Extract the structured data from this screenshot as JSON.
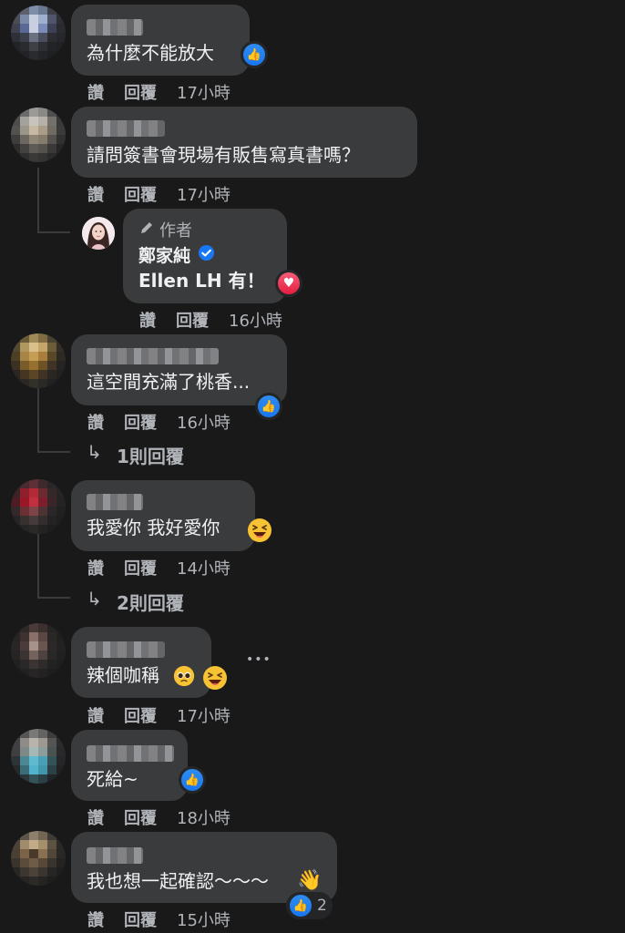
{
  "actions": {
    "like": "讚",
    "reply": "回覆"
  },
  "comments": [
    {
      "text": "為什麼不能放大",
      "time": "17小時"
    },
    {
      "text": "請問簽書會現場有販售寫真書嗎？",
      "time": "17小時"
    },
    {
      "author_badge": "作者",
      "author_name": "鄭家純",
      "text": "Ellen LH 有！",
      "time": "16小時"
    },
    {
      "text": "這空間充滿了桃香...",
      "time": "16小時",
      "replies": "1則回覆"
    },
    {
      "text": "我愛你 我好愛你",
      "time": "14小時",
      "replies": "2則回覆"
    },
    {
      "text": "辣個咖稱",
      "time": "17小時"
    },
    {
      "text": "死給~",
      "time": "18小時"
    },
    {
      "text": "我也想一起確認～～～",
      "time": "15小時",
      "reaction_count": "2"
    }
  ],
  "more_options": "•••",
  "colors": {
    "background": "#19191a",
    "bubble": "#3a3b3c",
    "like_blue": "#1877f2",
    "love_red": "#e41e3f",
    "verified_blue": "#1877f2"
  },
  "icons": [
    "like-icon",
    "love-icon",
    "verified-icon",
    "pencil-icon",
    "reply-arrow-icon",
    "laughing-emoji",
    "pleading-emoji",
    "waving-hand-emoji"
  ]
}
